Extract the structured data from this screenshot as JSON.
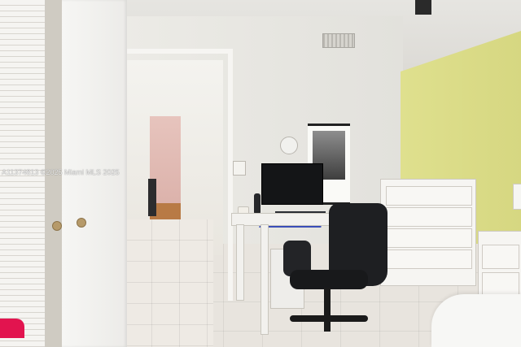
{
  "photo": {
    "watermark": "A11374813 ©2025 Miami MLS 2025"
  },
  "colors": {
    "yellow_wall": "#dcdd88",
    "mousepad": "#3a4eb8",
    "pink_room": "#e2bcb4",
    "accent_pink": "#e2144f"
  }
}
